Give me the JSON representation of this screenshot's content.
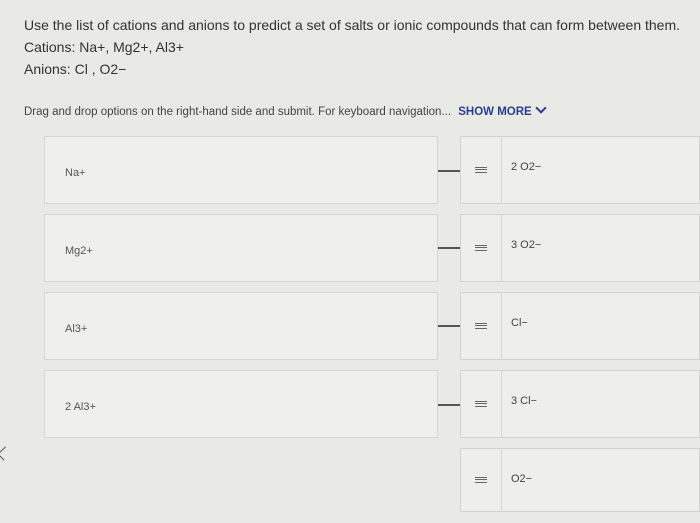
{
  "question": {
    "line1": "Use the list of cations and anions to predict a set of salts or ionic compounds that can form between them.",
    "line2": "Cations: Na+, Mg2+, Al3+",
    "line3": "Anions: Cl  , O2−"
  },
  "instructions": {
    "text": "Drag and drop options on the right-hand side and submit. For keyboard navigation...",
    "show_more": "SHOW MORE"
  },
  "targets": [
    {
      "label": "Na+"
    },
    {
      "label": "Mg2+"
    },
    {
      "label": "Al3+"
    },
    {
      "label": "2 Al3+"
    }
  ],
  "options": [
    {
      "label": "2 O2−"
    },
    {
      "label": "3 O2−"
    },
    {
      "label": "Cl−"
    },
    {
      "label": "3 Cl−"
    },
    {
      "label": "O2−"
    }
  ],
  "icons": {
    "grip": "drag-handle-icon",
    "show_more": "chevron-down-icon"
  }
}
